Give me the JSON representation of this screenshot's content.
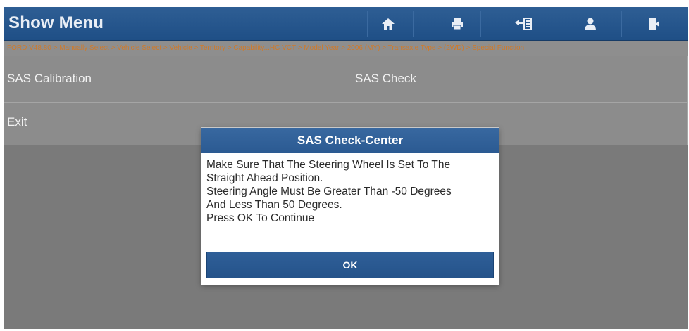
{
  "header": {
    "title": "Show Menu",
    "icons": [
      "home-icon",
      "print-icon",
      "report-icon",
      "user-icon",
      "exit-icon"
    ]
  },
  "breadcrumb": "FORD V48.80 > Manually Select > Vehicle Select > Vehicle > Territory > Capability...HC VCT > Model Year > 2006 (MY) > Transaxle Type > (2WD) > Special Function",
  "menu": {
    "items": [
      "SAS Calibration",
      "SAS Check",
      "Exit",
      ""
    ]
  },
  "dialog": {
    "title": "SAS Check-Center",
    "lines": [
      "Make Sure That The Steering Wheel Is Set To The",
      "Straight Ahead Position.",
      "Steering Angle Must Be Greater Than -50 Degrees",
      "And Less Than 50 Degrees.",
      "Press OK To Continue"
    ],
    "ok_label": "OK"
  },
  "colors": {
    "header_blue": "#2b5a92",
    "breadcrumb_orange": "#d07a2a",
    "dim_background": "#8c8c8c"
  }
}
